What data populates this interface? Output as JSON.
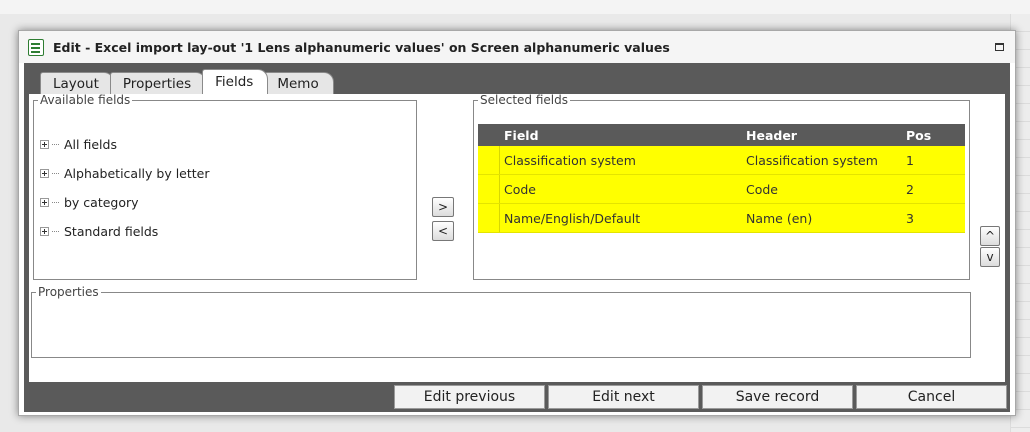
{
  "window": {
    "title": "Edit - Excel import lay-out '1 Lens alphanumeric values' on Screen alphanumeric values"
  },
  "tabs": [
    {
      "label": "Layout",
      "active": false
    },
    {
      "label": "Properties",
      "active": false
    },
    {
      "label": "Fields",
      "active": true
    },
    {
      "label": "Memo",
      "active": false
    }
  ],
  "available_fields": {
    "legend": "Available fields",
    "items": [
      "All fields",
      "Alphabetically by letter",
      "by category",
      "Standard fields"
    ]
  },
  "transfer_buttons": {
    "add": ">",
    "remove": "<"
  },
  "selected_fields": {
    "legend": "Selected fields",
    "columns": {
      "field": "Field",
      "header": "Header",
      "pos": "Pos"
    },
    "rows": [
      {
        "field": "Classification system",
        "header": "Classification system",
        "pos": "1"
      },
      {
        "field": "Code",
        "header": "Code",
        "pos": "2"
      },
      {
        "field": "Name/English/Default",
        "header": "Name (en)",
        "pos": "3"
      }
    ],
    "row_highlight_color": "#ffff00"
  },
  "order_buttons": {
    "up": "^",
    "down": "v"
  },
  "properties": {
    "legend": "Properties"
  },
  "footer": {
    "edit_previous": "Edit previous",
    "edit_next": "Edit next",
    "save_record": "Save record",
    "cancel": "Cancel"
  }
}
